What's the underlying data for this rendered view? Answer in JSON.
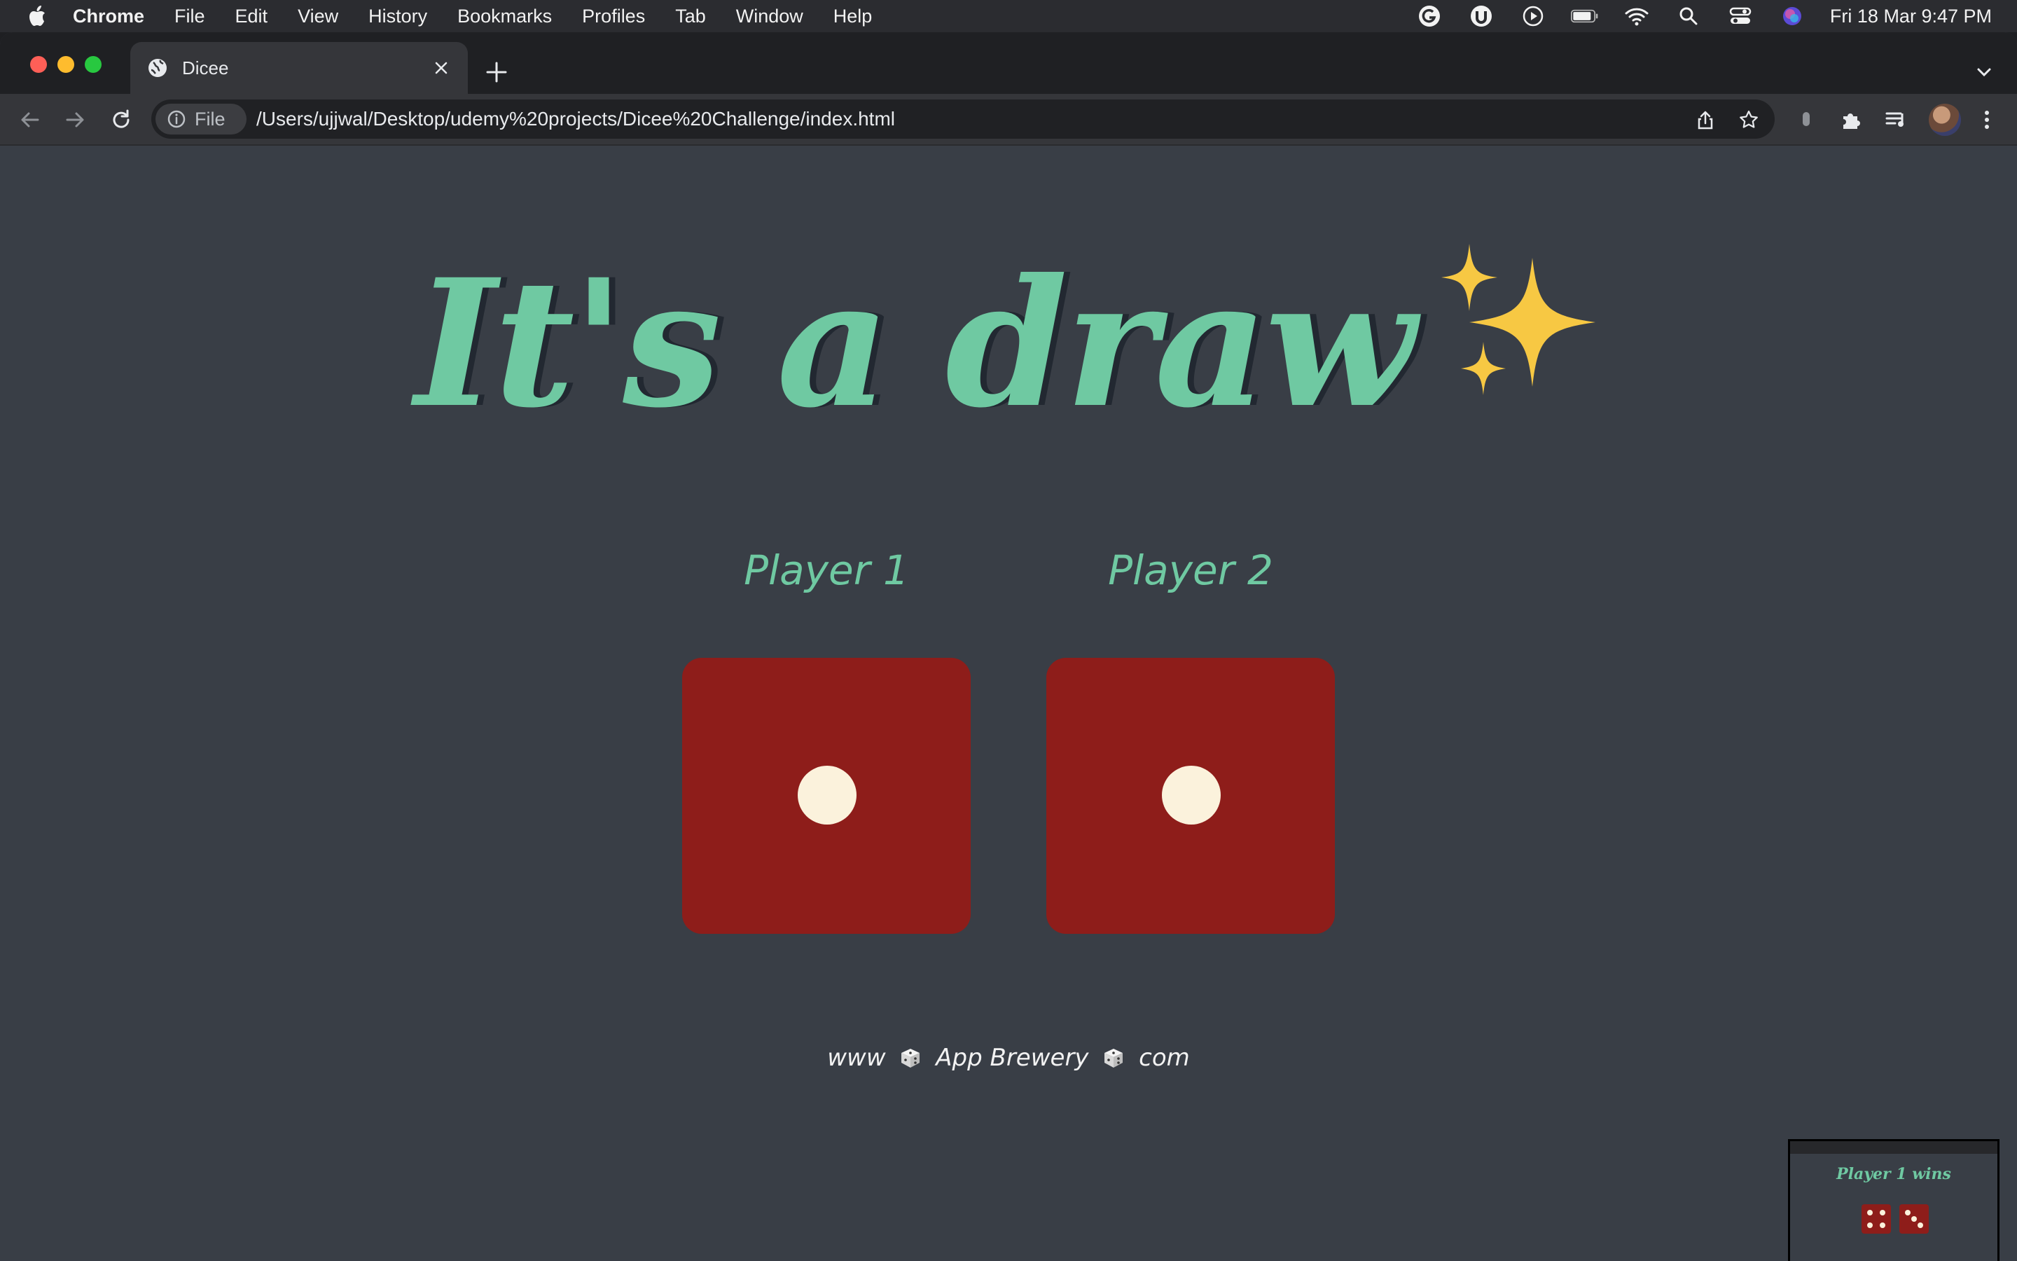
{
  "menubar": {
    "app_name": "Chrome",
    "items": [
      "File",
      "Edit",
      "View",
      "History",
      "Bookmarks",
      "Profiles",
      "Tab",
      "Window",
      "Help"
    ],
    "clock": "Fri 18 Mar  9:47 PM"
  },
  "browser": {
    "tab_title": "Dicee",
    "omnibox_chip": "File",
    "url": "/Users/ujjwal/Desktop/udemy%20projects/Dicee%20Challenge/index.html"
  },
  "page": {
    "headline": "It's a draw",
    "headline_emoji": "sparkles-icon",
    "player1_label": "Player 1",
    "player2_label": "Player 2",
    "player1_die_value": 1,
    "player2_die_value": 1,
    "footer_prefix": "www",
    "footer_middle": "App Brewery",
    "footer_suffix": "com"
  },
  "thumbnail": {
    "title": "Player 1 wins"
  },
  "colors": {
    "page_bg": "#393e46",
    "accent_green": "#6fc9a2",
    "die_red": "#8e1d1a",
    "pip_cream": "#fbf2dc"
  }
}
